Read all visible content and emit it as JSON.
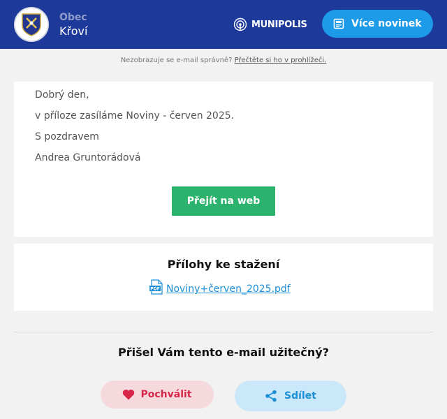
{
  "header": {
    "org_prefix": "Obec",
    "org_name": "Křoví",
    "brand": "MUNIPOLIS",
    "more_news_label": "Více novinek"
  },
  "notice": {
    "text": "Nezobrazuje se e-mail správně?",
    "link": "Přečtěte si ho v prohlížeči."
  },
  "message": {
    "greeting": "Dobrý den,",
    "body": "v příloze zasíláme Noviny - červen 2025.",
    "closing": "S pozdravem",
    "signature": "Andrea Gruntorádová",
    "web_button": "Přejít na web"
  },
  "attachments": {
    "title": "Přílohy ke stažení",
    "files": [
      {
        "name": "Noviny+červen_2025.pdf",
        "icon": "pdf-icon"
      }
    ]
  },
  "feedback": {
    "question": "Přišel Vám tento e-mail užitečný?",
    "like_label": "Pochválit",
    "share_label": "Sdílet"
  },
  "colors": {
    "header_bg": "#1d3a9a",
    "accent_blue": "#1d9be8",
    "web_button": "#2bb36e",
    "like_text": "#d6274a",
    "like_bg": "#f6d9dd",
    "share_bg": "#cbe8fa",
    "link": "#1a8fd6"
  }
}
